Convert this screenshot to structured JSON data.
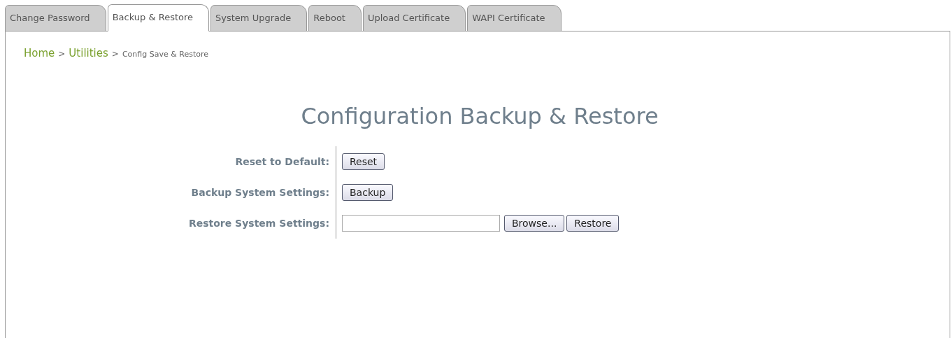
{
  "tabs": [
    {
      "label": "Change Password",
      "selected": false
    },
    {
      "label": "Backup & Restore",
      "selected": true
    },
    {
      "label": "System Upgrade",
      "selected": false
    },
    {
      "label": "Reboot",
      "selected": false
    },
    {
      "label": "Upload Certificate",
      "selected": false
    },
    {
      "label": "WAPI Certificate",
      "selected": false
    }
  ],
  "breadcrumb": [
    {
      "kind": "link",
      "label": "Home"
    },
    {
      "kind": "separator",
      "label": ">"
    },
    {
      "kind": "link",
      "label": "Utilities"
    },
    {
      "kind": "separator",
      "label": ">"
    },
    {
      "kind": "current",
      "label": "Config Save & Restore"
    }
  ],
  "title": "Configuration Backup & Restore",
  "rows": [
    {
      "label": "Reset to Default:",
      "controls": [
        {
          "kind": "button",
          "label": "Reset"
        }
      ]
    },
    {
      "label": "Backup System Settings:",
      "controls": [
        {
          "kind": "button",
          "label": "Backup"
        }
      ]
    },
    {
      "label": "Restore System Settings:",
      "controls": [
        {
          "kind": "file"
        },
        {
          "kind": "button",
          "label": "Browse..."
        },
        {
          "kind": "button",
          "label": "Restore"
        }
      ]
    }
  ]
}
